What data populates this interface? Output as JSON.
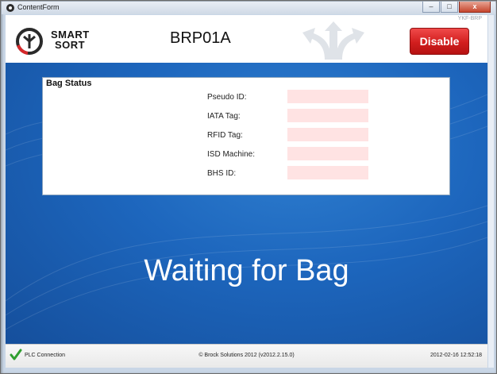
{
  "window": {
    "title": "ContentForm",
    "controls": {
      "minimize": "–",
      "maximize": "□",
      "close": "x"
    }
  },
  "header": {
    "station_code": "YKF-BRP",
    "brand_line1": "SMART",
    "brand_line2": "SORT",
    "station_name": "BRP01A",
    "disable_label": "Disable",
    "accent_color": "#d21e1e"
  },
  "bag_status": {
    "title": "Bag Status",
    "fields": [
      {
        "label": "Pseudo ID:",
        "value": ""
      },
      {
        "label": "IATA Tag:",
        "value": ""
      },
      {
        "label": "RFID Tag:",
        "value": ""
      },
      {
        "label": "ISD Machine:",
        "value": ""
      },
      {
        "label": "BHS ID:",
        "value": ""
      }
    ]
  },
  "main": {
    "status_message": "Waiting for Bag",
    "background_color": "#1d66bd"
  },
  "statusbar": {
    "connection_label": "PLC Connection",
    "connection_icon": "check-icon",
    "copyright": "© Brock Solutions 2012 (v2012.2.15.0)",
    "datetime": "2012-02-16 12:52:18"
  }
}
